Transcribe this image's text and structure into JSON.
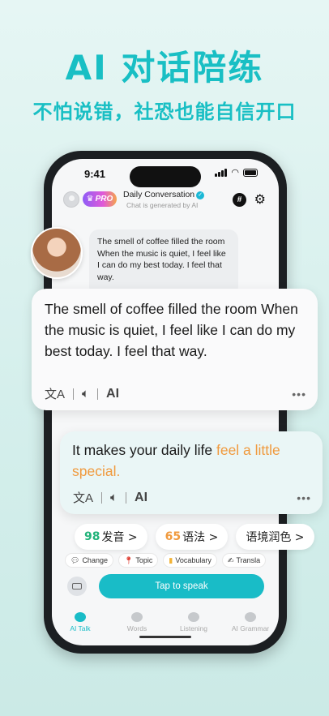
{
  "hero": {
    "title": "AI 对话陪练",
    "subtitle": "不怕说错，社恐也能自信开口"
  },
  "status_bar": {
    "time": "9:41"
  },
  "header": {
    "badge": "PRO",
    "title": "Daily Conversation",
    "subtitle": "Chat is generated by AI"
  },
  "messages": {
    "small_text": "The smell of coffee filled the room When the music is quiet, I feel like I can do my best today. I feel that way.",
    "ai_text": "The smell of coffee filled the room When the music is quiet, I feel like I can do my best today. I feel that way.",
    "reply_plain": "It makes your daily life ",
    "reply_highlight": "feel a little special.",
    "ai_label": "AI",
    "more": "•••"
  },
  "scores": [
    {
      "score": "98",
      "label": "发音 >",
      "color": "#22b37a"
    },
    {
      "score": "65",
      "label": "语法 >",
      "color": "#f09a3e"
    },
    {
      "score": "",
      "label": "语境润色 >"
    }
  ],
  "chips": [
    {
      "icon": "speech-bubble",
      "label": "Change"
    },
    {
      "icon": "pin",
      "label": "Topic"
    },
    {
      "icon": "notebook",
      "label": "Vocabulary"
    },
    {
      "icon": "pencil",
      "label": "Transla"
    }
  ],
  "speak_button": "Tap to speak",
  "tabs": [
    {
      "label": "AI Talk",
      "active": true
    },
    {
      "label": "Words",
      "active": false
    },
    {
      "label": "Listening",
      "active": false
    },
    {
      "label": "AI Grammar",
      "active": false
    }
  ],
  "colors": {
    "accent": "#19bcc7",
    "highlight": "#f09a3e",
    "good": "#22b37a"
  }
}
